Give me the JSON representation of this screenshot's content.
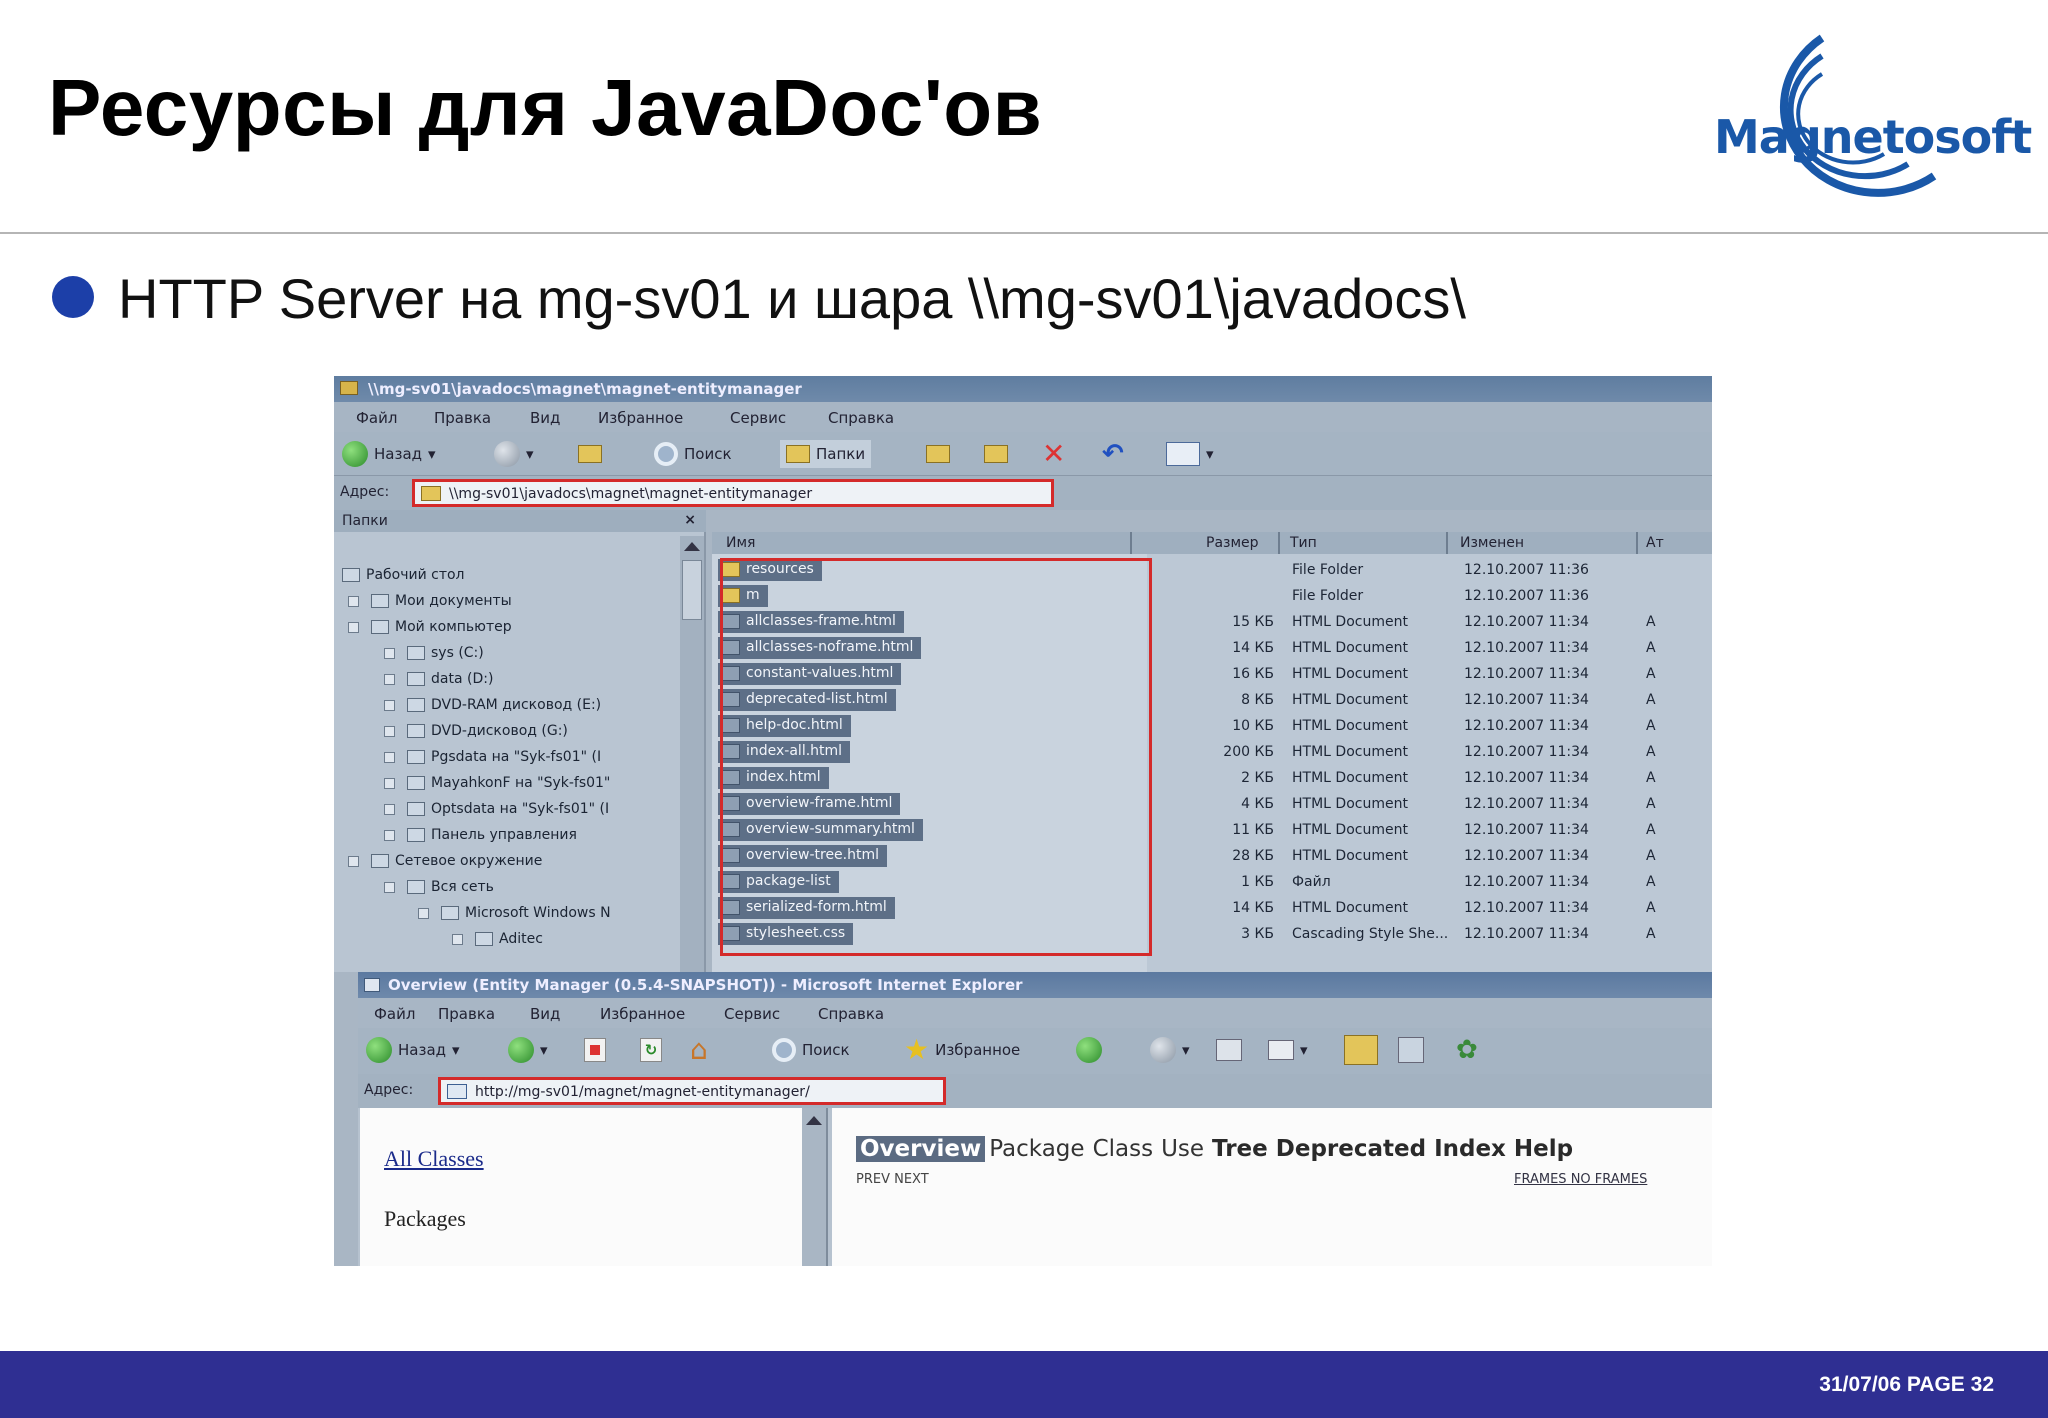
{
  "slide": {
    "title": "Ресурсы для JavaDoc'ов",
    "logo_text": "Magnetosoft",
    "bullet": "HTTP Server на mg-sv01 и шара \\\\mg-sv01\\javadocs\\",
    "footer": "31/07/06 PAGE 32",
    "colors": {
      "footer_bar": "#2f2f92",
      "bullet": "#1c3fa8",
      "logo": "#1a58a8",
      "highlight_box": "#d42a2a"
    }
  },
  "explorer": {
    "title": "\\\\mg-sv01\\javadocs\\magnet\\magnet-entitymanager",
    "menu": [
      "Файл",
      "Правка",
      "Вид",
      "Избранное",
      "Сервис",
      "Справка"
    ],
    "toolbar": {
      "back": "Назад",
      "search": "Поиск",
      "folders": "Папки"
    },
    "address_label": "Адрес:",
    "address": "\\\\mg-sv01\\javadocs\\magnet\\magnet-entitymanager",
    "folders_pane_title": "Папки",
    "tree": [
      "Рабочий стол",
      "Мои документы",
      "Мой компьютер",
      "sys (C:)",
      "data (D:)",
      "DVD-RAM дисковод (E:)",
      "DVD-дисковод (G:)",
      "Pgsdata на \"Syk-fs01\" (I",
      "MayahkonF на \"Syk-fs01\"",
      "Optsdata на \"Syk-fs01\" (I",
      "Панель управления",
      "Сетевое окружение",
      "Вся сеть",
      "Microsoft Windows N",
      "Aditec"
    ],
    "columns": {
      "name": "Имя",
      "size": "Размер",
      "type": "Тип",
      "modified": "Изменен",
      "attr": "Ат"
    },
    "files": [
      {
        "name": "resources",
        "size": "",
        "type": "File Folder",
        "date": "12.10.2007 11:36",
        "attr": "",
        "folder": true
      },
      {
        "name": "m",
        "size": "",
        "type": "File Folder",
        "date": "12.10.2007 11:36",
        "attr": "",
        "folder": true
      },
      {
        "name": "allclasses-frame.html",
        "size": "15 КБ",
        "type": "HTML Document",
        "date": "12.10.2007 11:34",
        "attr": "A"
      },
      {
        "name": "allclasses-noframe.html",
        "size": "14 КБ",
        "type": "HTML Document",
        "date": "12.10.2007 11:34",
        "attr": "A"
      },
      {
        "name": "constant-values.html",
        "size": "16 КБ",
        "type": "HTML Document",
        "date": "12.10.2007 11:34",
        "attr": "A"
      },
      {
        "name": "deprecated-list.html",
        "size": "8 КБ",
        "type": "HTML Document",
        "date": "12.10.2007 11:34",
        "attr": "A"
      },
      {
        "name": "help-doc.html",
        "size": "10 КБ",
        "type": "HTML Document",
        "date": "12.10.2007 11:34",
        "attr": "A"
      },
      {
        "name": "index-all.html",
        "size": "200 КБ",
        "type": "HTML Document",
        "date": "12.10.2007 11:34",
        "attr": "A"
      },
      {
        "name": "index.html",
        "size": "2 КБ",
        "type": "HTML Document",
        "date": "12.10.2007 11:34",
        "attr": "A"
      },
      {
        "name": "overview-frame.html",
        "size": "4 КБ",
        "type": "HTML Document",
        "date": "12.10.2007 11:34",
        "attr": "A"
      },
      {
        "name": "overview-summary.html",
        "size": "11 КБ",
        "type": "HTML Document",
        "date": "12.10.2007 11:34",
        "attr": "A"
      },
      {
        "name": "overview-tree.html",
        "size": "28 КБ",
        "type": "HTML Document",
        "date": "12.10.2007 11:34",
        "attr": "A"
      },
      {
        "name": "package-list",
        "size": "1 КБ",
        "type": "Файл",
        "date": "12.10.2007 11:34",
        "attr": "A"
      },
      {
        "name": "serialized-form.html",
        "size": "14 КБ",
        "type": "HTML Document",
        "date": "12.10.2007 11:34",
        "attr": "A"
      },
      {
        "name": "stylesheet.css",
        "size": "3 КБ",
        "type": "Cascading Style She...",
        "date": "12.10.2007 11:34",
        "attr": "A"
      }
    ]
  },
  "browser": {
    "title": "Overview (Entity Manager (0.5.4-SNAPSHOT)) - Microsoft Internet Explorer",
    "menu": [
      "Файл",
      "Правка",
      "Вид",
      "Избранное",
      "Сервис",
      "Справка"
    ],
    "toolbar": {
      "back": "Назад",
      "search": "Поиск",
      "favorites": "Избранное"
    },
    "address_label": "Адрес:",
    "address": "http://mg-sv01/magnet/magnet-entitymanager/",
    "left_frame": {
      "all_classes": "All Classes",
      "packages": "Packages"
    },
    "nav": [
      "Overview",
      "Package",
      "Class",
      "Use",
      "Tree",
      "Deprecated",
      "Index",
      "Help"
    ],
    "sub_nav_left": "PREV NEXT",
    "sub_nav_right": "FRAMES NO FRAMES"
  }
}
